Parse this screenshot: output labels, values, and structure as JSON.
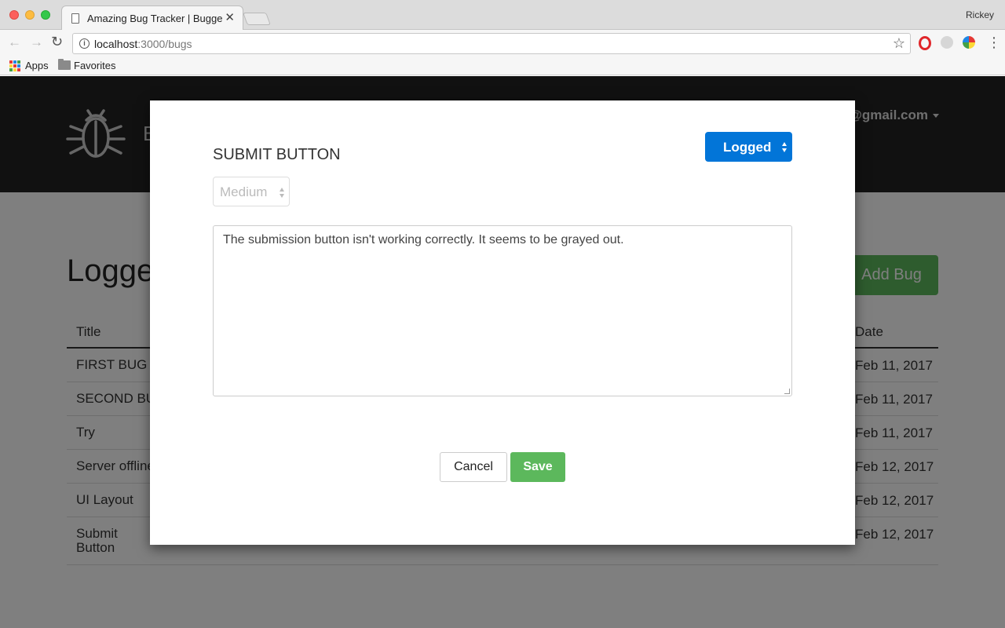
{
  "browser": {
    "tab_title": "Amazing Bug Tracker | Bugge",
    "profile": "Rickey",
    "url_host": "localhost",
    "url_path": ":3000/bugs",
    "bookmarks": [
      "Apps",
      "Favorites"
    ]
  },
  "header": {
    "brand": "B",
    "user_email": "@gmail.com"
  },
  "page": {
    "title": "Logge",
    "add_button": "Add Bug",
    "columns": {
      "title": "Title",
      "date": "Date"
    },
    "rows": [
      {
        "title": "FIRST BUG",
        "date": "Feb 11, 2017"
      },
      {
        "title": "SECOND BU",
        "date": "Feb 11, 2017"
      },
      {
        "title": "Try",
        "date": "Feb 11, 2017"
      },
      {
        "title": "Server offline",
        "date": "Feb 12, 2017"
      },
      {
        "title": "UI Layout",
        "date": "Feb 12, 2017"
      },
      {
        "title": "Submit Button",
        "date": "Feb 12, 2017"
      }
    ]
  },
  "modal": {
    "title": "SUBMIT BUTTON",
    "status": "Logged",
    "priority": "Medium",
    "description": "The submission button isn't working correctly. It seems to be grayed out.",
    "cancel": "Cancel",
    "save": "Save"
  },
  "colors": {
    "header_bg": "#222222",
    "primary": "#0275d8",
    "success": "#5cb85c",
    "overlay": "rgba(0,0,0,0.5)"
  },
  "icons": {
    "brand": "bug-icon",
    "tab": "page-icon",
    "security": "info-icon",
    "bookmark": "star-icon"
  }
}
